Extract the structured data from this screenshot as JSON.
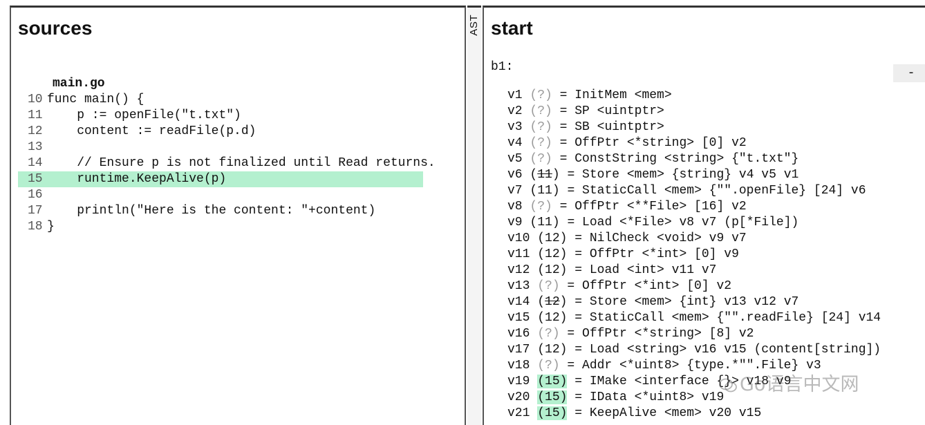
{
  "sources": {
    "title": "sources",
    "file_name": "main.go",
    "lines": [
      {
        "num": "10",
        "text": "func main() {",
        "highlighted": false
      },
      {
        "num": "11",
        "text": "    p := openFile(\"t.txt\")",
        "highlighted": false
      },
      {
        "num": "12",
        "text": "    content := readFile(p.d)",
        "highlighted": false
      },
      {
        "num": "13",
        "text": "",
        "highlighted": false
      },
      {
        "num": "14",
        "text": "    // Ensure p is not finalized until Read returns.",
        "highlighted": false
      },
      {
        "num": "15",
        "text": "    runtime.KeepAlive(p)",
        "highlighted": true
      },
      {
        "num": "16",
        "text": "",
        "highlighted": false
      },
      {
        "num": "17",
        "text": "    println(\"Here is the content: \"+content)",
        "highlighted": false
      },
      {
        "num": "18",
        "text": "}",
        "highlighted": false
      }
    ]
  },
  "ast_tab": {
    "label": "AST"
  },
  "start": {
    "title": "start",
    "block_label": "b1:",
    "collapse_label": "-",
    "values": [
      {
        "id": "v1",
        "pos": "(?)",
        "pos_state": "unknown",
        "rest": " = InitMem <mem>"
      },
      {
        "id": "v2",
        "pos": "(?)",
        "pos_state": "unknown",
        "rest": " = SP <uintptr>"
      },
      {
        "id": "v3",
        "pos": "(?)",
        "pos_state": "unknown",
        "rest": " = SB <uintptr>"
      },
      {
        "id": "v4",
        "pos": "(?)",
        "pos_state": "unknown",
        "rest": " = OffPtr <*string> [0] v2"
      },
      {
        "id": "v5",
        "pos": "(?)",
        "pos_state": "unknown",
        "rest": " = ConstString <string> {\"t.txt\"}"
      },
      {
        "id": "v6",
        "pos": "(11)",
        "pos_state": "struck",
        "rest": " = Store <mem> {string} v4 v5 v1"
      },
      {
        "id": "v7",
        "pos": "(11)",
        "pos_state": "normal",
        "rest": " = StaticCall <mem> {\"\".openFile} [24] v6"
      },
      {
        "id": "v8",
        "pos": "(?)",
        "pos_state": "unknown",
        "rest": " = OffPtr <**File> [16] v2"
      },
      {
        "id": "v9",
        "pos": "(11)",
        "pos_state": "normal",
        "rest": " = Load <*File> v8 v7 (p[*File])"
      },
      {
        "id": "v10",
        "pos": "(12)",
        "pos_state": "normal",
        "rest": " = NilCheck <void> v9 v7"
      },
      {
        "id": "v11",
        "pos": "(12)",
        "pos_state": "normal",
        "rest": " = OffPtr <*int> [0] v9"
      },
      {
        "id": "v12",
        "pos": "(12)",
        "pos_state": "normal",
        "rest": " = Load <int> v11 v7"
      },
      {
        "id": "v13",
        "pos": "(?)",
        "pos_state": "unknown",
        "rest": " = OffPtr <*int> [0] v2"
      },
      {
        "id": "v14",
        "pos": "(12)",
        "pos_state": "struck",
        "rest": " = Store <mem> {int} v13 v12 v7"
      },
      {
        "id": "v15",
        "pos": "(12)",
        "pos_state": "normal",
        "rest": " = StaticCall <mem> {\"\".readFile} [24] v14"
      },
      {
        "id": "v16",
        "pos": "(?)",
        "pos_state": "unknown",
        "rest": " = OffPtr <*string> [8] v2"
      },
      {
        "id": "v17",
        "pos": "(12)",
        "pos_state": "normal",
        "rest": " = Load <string> v16 v15 (content[string])"
      },
      {
        "id": "v18",
        "pos": "(?)",
        "pos_state": "unknown",
        "rest": " = Addr <*uint8> {type.*\"\".File} v3"
      },
      {
        "id": "v19",
        "pos": "(15)",
        "pos_state": "highlighted",
        "rest": " = IMake <interface {}> v18 v9"
      },
      {
        "id": "v20",
        "pos": "(15)",
        "pos_state": "highlighted",
        "rest": " = IData <*uint8> v19"
      },
      {
        "id": "v21",
        "pos": "(15)",
        "pos_state": "highlighted",
        "rest": " = KeepAlive <mem> v20 v15"
      }
    ]
  },
  "watermark": {
    "text": "Go语言中文网",
    "icon": "wechat-icon"
  },
  "colors": {
    "highlight": "#b4f0cf",
    "unknown_pos": "#999999",
    "border": "#555555"
  }
}
